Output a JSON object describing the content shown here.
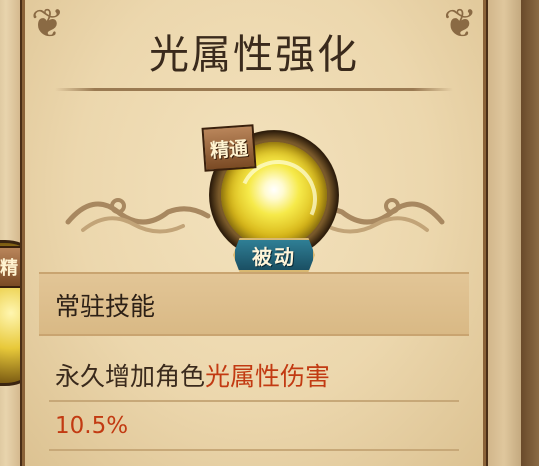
{
  "skill": {
    "title": "光属性强化",
    "mastery_badge": "精通",
    "passive_badge": "被动",
    "type_label": "常驻技能",
    "description_prefix": "永久增加角色",
    "description_highlight": "光属性伤害",
    "value": "10.5%"
  },
  "side_card": {
    "mastery_badge_partial": "精"
  },
  "colors": {
    "highlight": "#c23a12",
    "passive_badge": "#1a4f63",
    "parchment": "#ecd7ad"
  }
}
